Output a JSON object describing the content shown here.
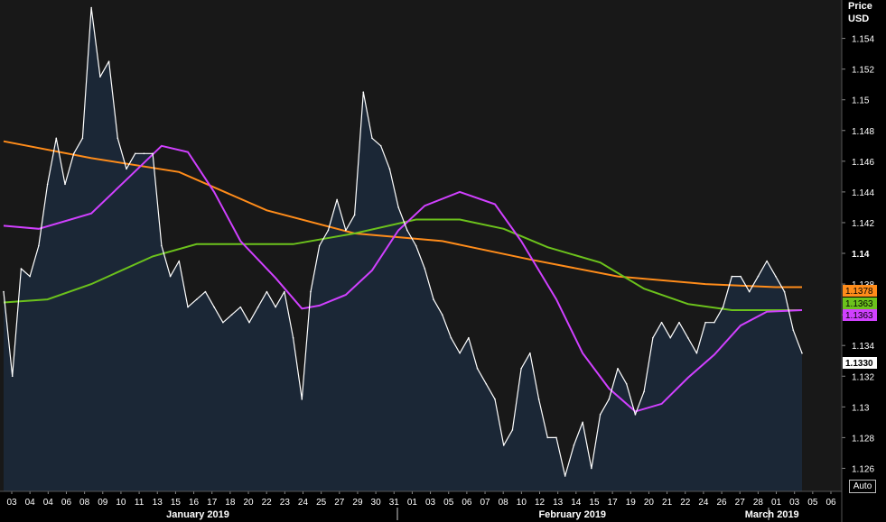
{
  "axis_header": {
    "title": "Price",
    "unit": "USD"
  },
  "auto_button": "Auto",
  "colors": {
    "background": "#181818",
    "price_line": "#ffffff",
    "price_fill": "#1c2a3c",
    "ma_orange": "#ff8c1a",
    "ma_green": "#6cc21c",
    "ma_magenta": "#d040ff",
    "grid": "#262626"
  },
  "chart_data": {
    "type": "line",
    "title": "",
    "ylabel": "Price USD",
    "ylim": [
      1.1245,
      1.1565
    ],
    "y_ticks": [
      "1.126",
      "1.128",
      "1.13",
      "1.132",
      "1.134",
      "1.136",
      "1.138",
      "1.14",
      "1.142",
      "1.144",
      "1.146",
      "1.148",
      "1.15",
      "1.152",
      "1.154"
    ],
    "bold_y_ticks": [
      "1.14"
    ],
    "x_day_labels": [
      "03",
      "04",
      "04",
      "06",
      "08",
      "09",
      "10",
      "11",
      "13",
      "15",
      "16",
      "17",
      "18",
      "20",
      "22",
      "23",
      "24",
      "25",
      "27",
      "29",
      "30",
      "31",
      "01",
      "03",
      "05",
      "06",
      "07",
      "08",
      "10",
      "12",
      "13",
      "14",
      "15",
      "17",
      "19",
      "20",
      "21",
      "22",
      "24",
      "26",
      "27",
      "28",
      "01",
      "03",
      "05",
      "06"
    ],
    "x_month_labels": [
      "January 2019",
      "February 2019",
      "March 2019"
    ],
    "grid": false,
    "series": [
      {
        "name": "price",
        "line": "price_line",
        "fill": true,
        "x": [
          0,
          1,
          2,
          3,
          4,
          5,
          6,
          7,
          8,
          9,
          10,
          11,
          12,
          13,
          14,
          15,
          16,
          17,
          18,
          19,
          20,
          21,
          22,
          23,
          24,
          25,
          26,
          27,
          28,
          29,
          30,
          31,
          32,
          33,
          34,
          35,
          36,
          37,
          38,
          39,
          40,
          41,
          42,
          43,
          44,
          45
        ],
        "values": [
          1.1375,
          1.132,
          1.139,
          1.1385,
          1.1405,
          1.1445,
          1.1475,
          1.1445,
          1.1465,
          1.1475,
          1.156,
          1.1515,
          1.1525,
          1.1475,
          1.1455,
          1.1465,
          1.1465,
          1.1465,
          1.1405,
          1.1385,
          1.1395,
          1.1365,
          1.137,
          1.1375,
          1.1365,
          1.1355,
          1.136,
          1.1365,
          1.1355,
          1.1365,
          1.1375,
          1.1365,
          1.1375,
          1.1345,
          1.1305,
          1.1375,
          1.1405,
          1.1415,
          1.1435,
          1.1415,
          1.1425,
          1.1505,
          1.1475,
          1.147,
          1.1455,
          1.143
        ]
      },
      {
        "name": "price_2",
        "line": "price_line",
        "fill": true,
        "x": [
          46,
          47,
          48,
          49,
          50,
          51,
          52,
          53,
          54,
          55,
          56,
          57,
          58,
          59,
          60,
          61,
          62,
          63,
          64,
          65,
          66,
          67,
          68,
          69,
          70,
          71,
          72,
          73,
          74,
          75,
          76,
          77,
          78,
          79,
          80,
          81,
          82,
          83,
          84,
          85,
          86,
          87,
          88,
          89,
          90,
          91
        ],
        "values": [
          1.1415,
          1.1405,
          1.139,
          1.137,
          1.136,
          1.1345,
          1.1335,
          1.1345,
          1.1325,
          1.1315,
          1.1305,
          1.1275,
          1.1285,
          1.1325,
          1.1335,
          1.1305,
          1.128,
          1.128,
          1.1255,
          1.1275,
          1.129,
          1.126,
          1.1295,
          1.1305,
          1.1325,
          1.1315,
          1.1295,
          1.131,
          1.1345,
          1.1355,
          1.1345,
          1.1355,
          1.1345,
          1.1335,
          1.1355,
          1.1355,
          1.1365,
          1.1385,
          1.1385,
          1.1375,
          1.1385,
          1.1395,
          1.1385,
          1.1375,
          1.135,
          1.1335
        ]
      },
      {
        "name": "ma_orange",
        "line": "ma_orange",
        "x": [
          0,
          10,
          20,
          30,
          40,
          50,
          60,
          70,
          80,
          88,
          91
        ],
        "values": [
          1.1473,
          1.1462,
          1.1453,
          1.1428,
          1.1413,
          1.1408,
          1.1396,
          1.1385,
          1.138,
          1.1378,
          1.1378
        ]
      },
      {
        "name": "ma_green",
        "line": "ma_green",
        "x": [
          0,
          5,
          10,
          17,
          22,
          33,
          40,
          47,
          52,
          57,
          62,
          68,
          73,
          78,
          83,
          88,
          91
        ],
        "values": [
          1.1368,
          1.137,
          1.138,
          1.1398,
          1.1406,
          1.1406,
          1.1413,
          1.1422,
          1.1422,
          1.1416,
          1.1404,
          1.1394,
          1.1377,
          1.1367,
          1.1363,
          1.1363,
          1.1363
        ]
      },
      {
        "name": "ma_magenta",
        "line": "ma_magenta",
        "x": [
          0,
          4,
          10,
          14,
          18,
          21,
          24,
          27,
          31,
          34,
          36,
          39,
          42,
          45,
          48,
          52,
          56,
          59,
          63,
          66,
          69,
          72,
          75,
          78,
          81,
          84,
          87,
          91
        ],
        "values": [
          1.1418,
          1.1416,
          1.1426,
          1.1448,
          1.147,
          1.1466,
          1.144,
          1.1408,
          1.1384,
          1.1364,
          1.1366,
          1.1373,
          1.1389,
          1.1415,
          1.1431,
          1.144,
          1.1432,
          1.1408,
          1.137,
          1.1335,
          1.1312,
          1.1297,
          1.1302,
          1.1319,
          1.1334,
          1.1353,
          1.1362,
          1.1363
        ]
      }
    ],
    "last_value_tags": [
      {
        "series": "ma_orange",
        "text": "1.1378",
        "value": 1.1378,
        "bg": "#ff8c1a",
        "fg": "#000000"
      },
      {
        "series": "ma_green",
        "text": "1.1363",
        "value": 1.1363,
        "bg": "#6cc21c",
        "fg": "#000000"
      },
      {
        "series": "ma_magenta",
        "text": "1.1363",
        "value": 1.1363,
        "bg": "#d040ff",
        "fg": "#000000"
      },
      {
        "series": "price",
        "text": "1.1330",
        "value": 1.133,
        "bg": "#ffffff",
        "fg": "#000000"
      }
    ]
  }
}
